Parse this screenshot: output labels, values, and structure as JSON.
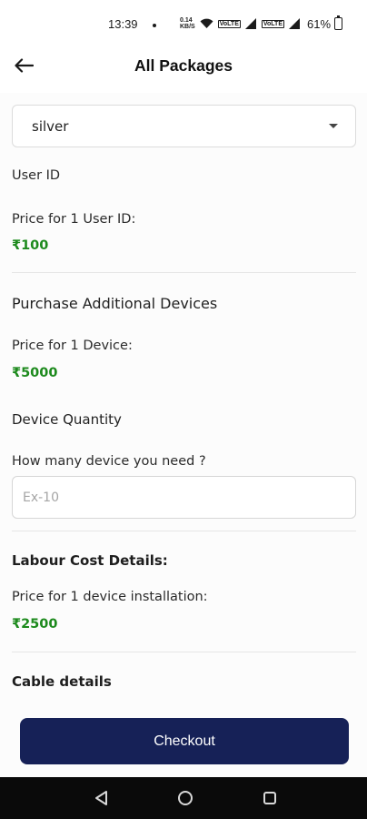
{
  "status_bar": {
    "time": "13:39",
    "speed_top": "0.14",
    "speed_bottom": "KB/S",
    "net1": "VoLTE",
    "net2": "VoLTE",
    "battery": "61%"
  },
  "app_bar": {
    "title": "All Packages",
    "back_icon": "arrow-left-icon"
  },
  "package_select": {
    "selected": "silver",
    "caret_icon": "caret-down-icon"
  },
  "user_id": {
    "heading": "User ID",
    "price_label": "Price for 1 User ID:",
    "price": "₹100"
  },
  "devices": {
    "heading": "Purchase Additional Devices",
    "price_label": "Price for 1 Device:",
    "price": "₹5000",
    "quantity_heading": "Device Quantity",
    "quantity_question": "How many device you need ?",
    "quantity_placeholder": "Ex-10",
    "quantity_value": ""
  },
  "labour": {
    "heading": "Labour Cost Details:",
    "price_label": "Price for 1 device installation:",
    "price": "₹2500"
  },
  "cable": {
    "heading": "Cable details"
  },
  "checkout": {
    "label": "Checkout"
  },
  "nav_bar": {
    "back_icon": "nav-back-icon",
    "home_icon": "nav-home-icon",
    "recents_icon": "nav-recents-icon"
  },
  "colors": {
    "accent": "#162157",
    "price_green": "#1d8a1d"
  }
}
